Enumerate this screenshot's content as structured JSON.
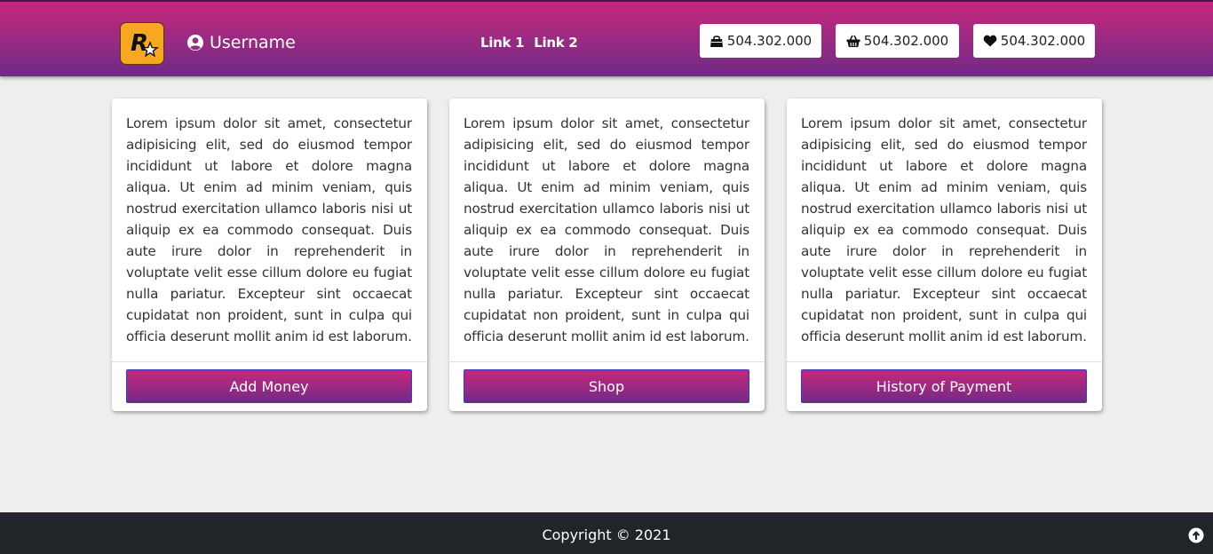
{
  "header": {
    "logo_alt": "R",
    "username": "Username",
    "nav": [
      {
        "label": "Link 1"
      },
      {
        "label": "Link 2"
      }
    ],
    "stats": [
      {
        "icon": "shopping-bag-icon",
        "value": "504.302.000"
      },
      {
        "icon": "shopping-basket-icon",
        "value": "504.302.000"
      },
      {
        "icon": "heart-icon",
        "value": "504.302.000"
      }
    ]
  },
  "cards": [
    {
      "text": "Lorem ipsum dolor sit amet, consectetur adipisicing elit, sed do eiusmod tempor incididunt ut labore et dolore magna aliqua. Ut enim ad minim veniam, quis nostrud exercitation ullamco laboris nisi ut aliquip ex ea commodo consequat. Duis aute irure dolor in reprehenderit in voluptate velit esse cillum dolore eu fugiat nulla pariatur. Excepteur sint occaecat cupidatat non proident, sunt in culpa qui officia deserunt mollit anim id est laborum.",
      "button": "Add Money"
    },
    {
      "text": "Lorem ipsum dolor sit amet, consectetur adipisicing elit, sed do eiusmod tempor incididunt ut labore et dolore magna aliqua. Ut enim ad minim veniam, quis nostrud exercitation ullamco laboris nisi ut aliquip ex ea commodo consequat. Duis aute irure dolor in reprehenderit in voluptate velit esse cillum dolore eu fugiat nulla pariatur. Excepteur sint occaecat cupidatat non proident, sunt in culpa qui officia deserunt mollit anim id est laborum.",
      "button": "Shop"
    },
    {
      "text": "Lorem ipsum dolor sit amet, consectetur adipisicing elit, sed do eiusmod tempor incididunt ut labore et dolore magna aliqua. Ut enim ad minim veniam, quis nostrud exercitation ullamco laboris nisi ut aliquip ex ea commodo consequat. Duis aute irure dolor in reprehenderit in voluptate velit esse cillum dolore eu fugiat nulla pariatur. Excepteur sint occaecat cupidatat non proident, sunt in culpa qui officia deserunt mollit anim id est laborum.",
      "button": "History of Payment"
    }
  ],
  "footer": {
    "copyright": "Copyright © 2021",
    "scroll_top_icon": "arrow-circle-up-icon"
  },
  "colors": {
    "accent_top": "#c4267a",
    "accent_bottom": "#6e2a86",
    "page_bg": "#eeeeee",
    "footer_bg": "#212529",
    "logo_bg": "#f7a823"
  }
}
